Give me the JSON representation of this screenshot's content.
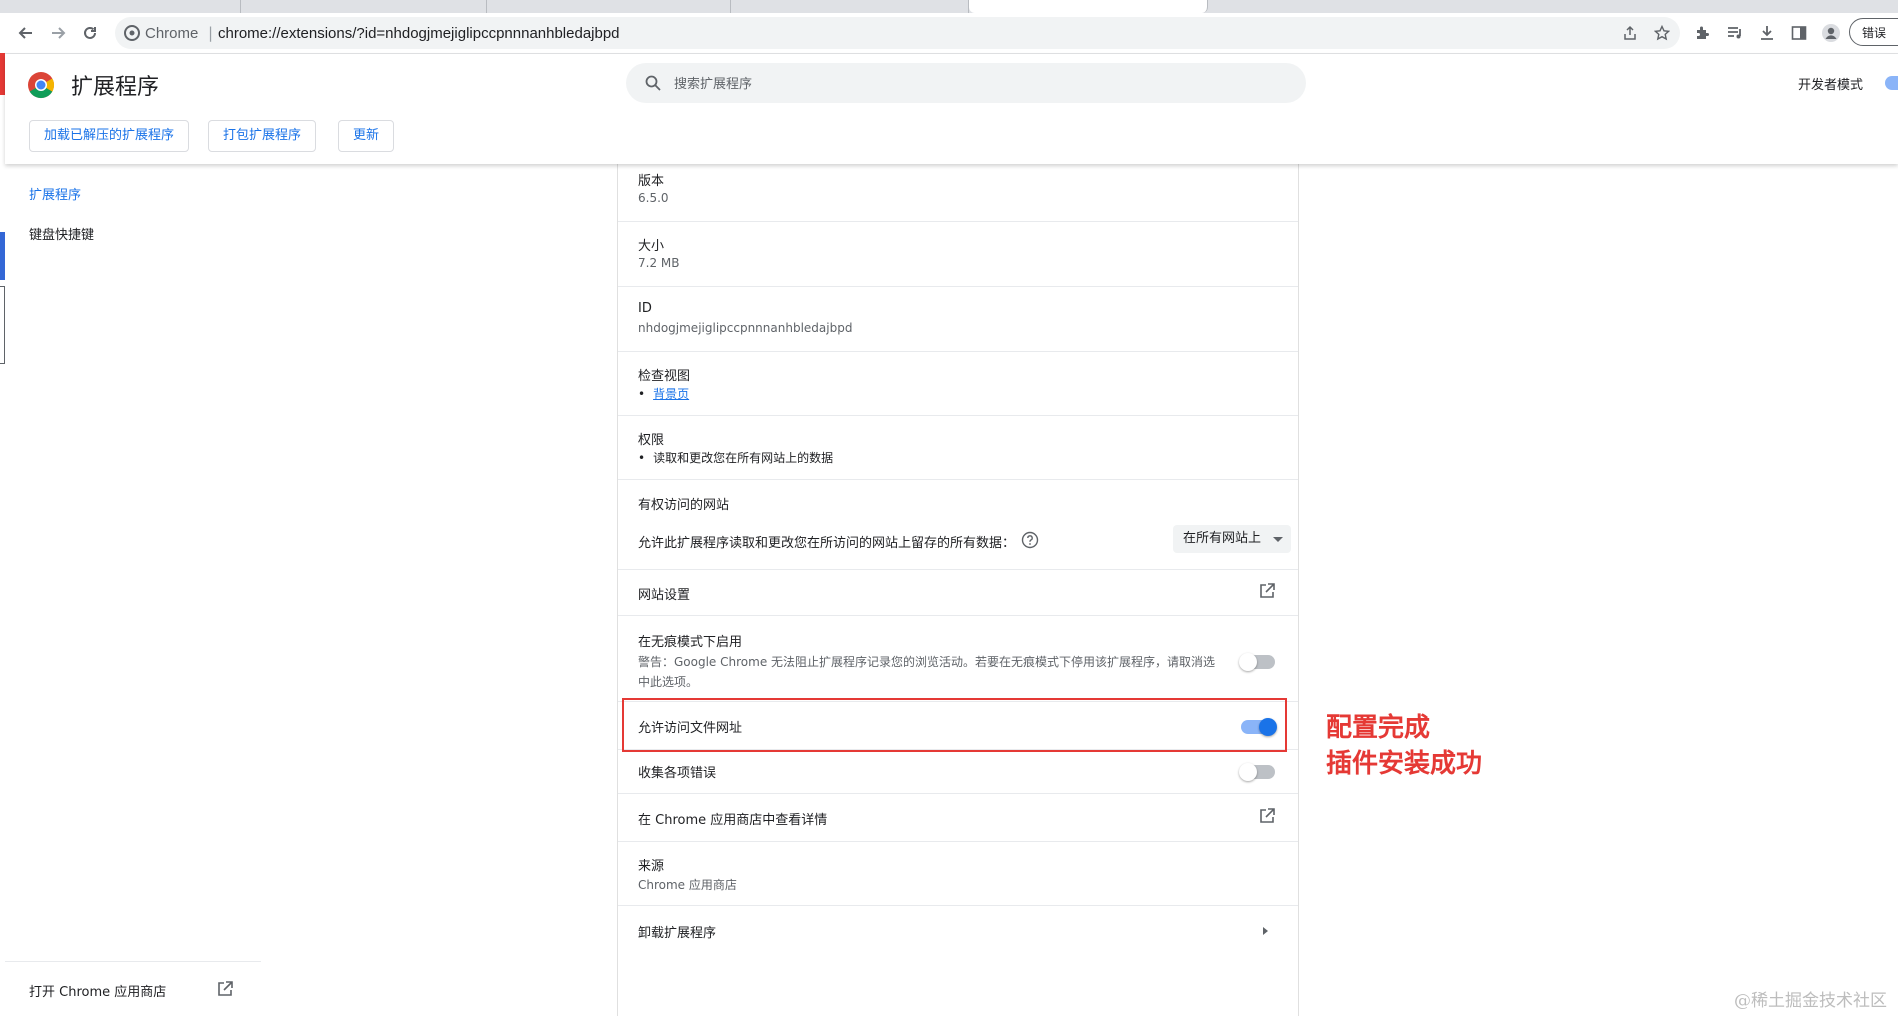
{
  "browser": {
    "origin_label": "Chrome",
    "url": "chrome://extensions/?id=nhdogjmejiglipccpnnnanhbledajbpd",
    "error_pill": "错误"
  },
  "header": {
    "title": "扩展程序",
    "search_placeholder": "搜索扩展程序",
    "dev_mode_label": "开发者模式",
    "dev_mode_on": true,
    "buttons": {
      "load_unpacked": "加载已解压的扩展程序",
      "pack": "打包扩展程序",
      "update": "更新"
    }
  },
  "sidebar": {
    "items": [
      {
        "label": "扩展程序",
        "active": true
      },
      {
        "label": "键盘快捷键",
        "active": false
      }
    ],
    "store_link": "打开 Chrome 应用商店"
  },
  "details": {
    "version": {
      "label": "版本",
      "value": "6.5.0"
    },
    "size": {
      "label": "大小",
      "value": "7.2 MB"
    },
    "id": {
      "label": "ID",
      "value": "nhdogjmejiglipccpnnnanhbledajbpd"
    },
    "inspect_views": {
      "label": "检查视图",
      "link": "背景页"
    },
    "permissions": {
      "label": "权限",
      "item": "读取和更改您在所有网站上的数据"
    },
    "site_access": {
      "label": "有权访问的网站",
      "description": "允许此扩展程序读取和更改您在所访问的网站上留存的所有数据：",
      "selected": "在所有网站上"
    },
    "site_settings": {
      "label": "网站设置"
    },
    "incognito": {
      "label": "在无痕模式下启用",
      "warning": "警告：Google Chrome 无法阻止扩展程序记录您的浏览活动。若要在无痕模式下停用该扩展程序，请取消选中此选项。",
      "enabled": false
    },
    "file_urls": {
      "label": "允许访问文件网址",
      "enabled": true
    },
    "collect_errors": {
      "label": "收集各项错误",
      "enabled": false
    },
    "webstore": {
      "label": "在 Chrome 应用商店中查看详情"
    },
    "source": {
      "label": "来源",
      "value": "Chrome 应用商店"
    },
    "remove": {
      "label": "卸载扩展程序"
    }
  },
  "annotation": {
    "line1": "配置完成",
    "line2": "插件安装成功",
    "color": "#e53935"
  },
  "watermark": "@稀土掘金技术社区",
  "colors": {
    "accent": "#1a73e8",
    "toggle_track_on": "#8ab4f8",
    "toggle_track_off": "#bdc1c6"
  }
}
